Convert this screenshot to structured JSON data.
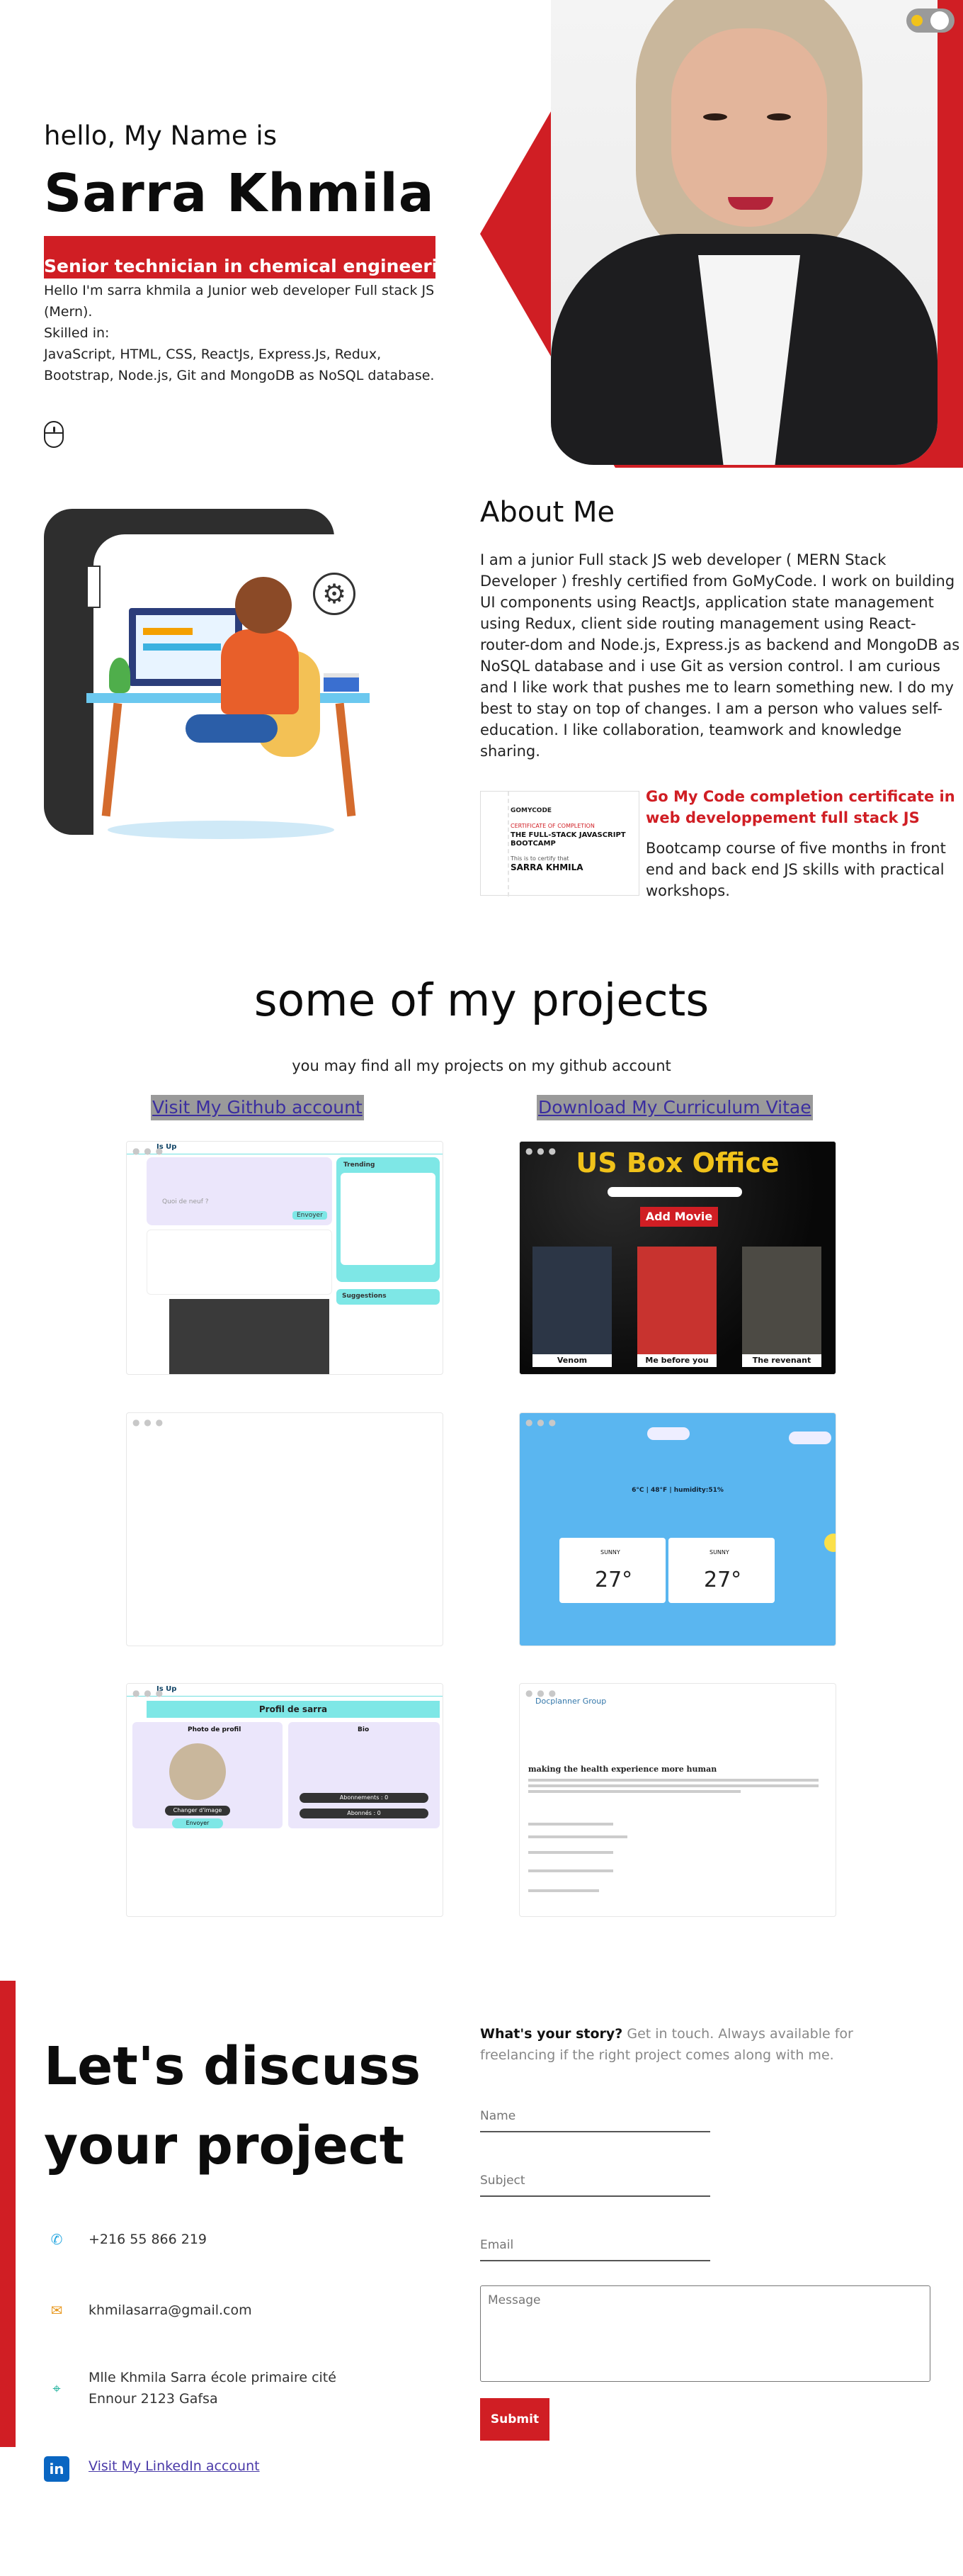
{
  "hero": {
    "greeting": "hello, My Name is",
    "name": "Sarra Khmila",
    "role": "Senior technician in chemical engineering",
    "intro": "Hello I'm sarra khmila a Junior web developer Full stack JS (Mern).\nSkilled in:\nJavaScript, HTML, CSS, ReactJs, Express.Js, Redux, Bootstrap, Node.js, Git and MongoDB as NoSQL database."
  },
  "about": {
    "title": "About Me",
    "text": "I am a junior Full stack JS web developer ( MERN Stack Developer ) freshly certified from GoMyCode. I work on building UI components using ReactJs, application state management using Redux, client side routing management using React-router-dom and Node.js, Express.js as backend and MongoDB as NoSQL database and i use Git as version control. I am curious and I like work that pushes me to learn something new. I do my best to stay on top of changes. I am a person who values self-education. I like collaboration, teamwork and knowledge sharing.",
    "certificate": {
      "title": "Go My Code completion certificate in web developpement full stack JS",
      "text": "Bootcamp course of five months in front end and back end JS skills with practical workshops.",
      "image_lines": [
        "GOMYCODE",
        "CERTIFICATE OF COMPLETION",
        "THE FULL-STACK JAVASCRIPT BOOTCAMP",
        "This is to certify that",
        "SARRA KHMILA"
      ]
    }
  },
  "projects": {
    "title": "some of my projects",
    "subtitle": "you may find all my projects on my github account",
    "github_link": "Visit My Github account",
    "cv_link": "Download My Curriculum Vitae",
    "cards": {
      "social": {
        "logo": "Is Up",
        "trending": "Trending",
        "suggestions": "Suggestions",
        "post_placeholder": "Quoi de neuf ?",
        "send": "Envoyer"
      },
      "boxoffice": {
        "title": "US Box Office",
        "add": "Add Movie",
        "movies": [
          "Venom",
          "Me before you",
          "The revenant"
        ]
      },
      "weather": {
        "info": "6°C | 48°F | humidity:51%",
        "temps": [
          "27°",
          "27°"
        ],
        "day": "SUNNY"
      },
      "profile": {
        "logo": "Is Up",
        "title": "Profil de sarra",
        "photo": "Photo de profil",
        "bio": "Bio",
        "change": "Changer d'image",
        "send": "Envoyer",
        "subscriptions": "Abonnements : 0",
        "followers": "Abonnés : 0"
      },
      "doc": {
        "logo": "Docplanner Group",
        "heading": "making the health experience more human"
      }
    }
  },
  "contact": {
    "heading": "Let's discuss your project",
    "phone": "+216 55 866 219",
    "email": "khmilasarra@gmail.com",
    "address": "Mlle Khmila Sarra école primaire cité Ennour 2123 Gafsa",
    "linkedin": "Visit My LinkedIn account",
    "story_bold": "What's your story?",
    "story_text": " Get in touch. Always available for freelancing if the right project comes along with me.",
    "form": {
      "name_placeholder": "Name",
      "subject_placeholder": "Subject",
      "email_placeholder": "Email",
      "message_placeholder": "Message",
      "submit": "Submit"
    }
  },
  "colors": {
    "accent": "#d01e24",
    "link": "#4a3aa8",
    "teal": "#7ee7e6",
    "weather_bg": "#5ab6f0"
  }
}
